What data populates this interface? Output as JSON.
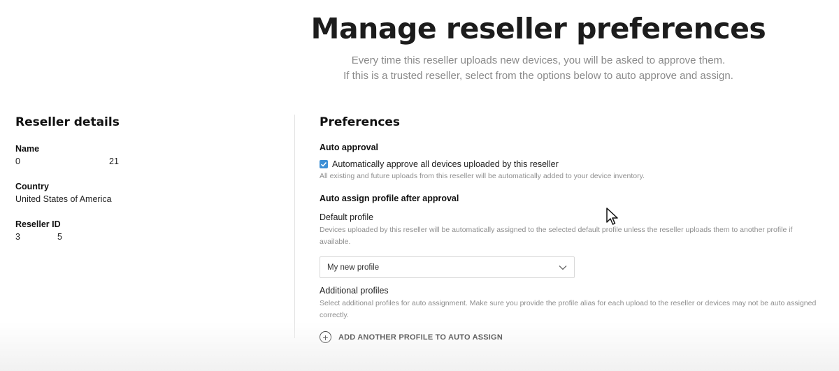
{
  "header": {
    "title": "Manage reseller preferences",
    "subtitle_line1": "Every time this reseller uploads new devices, you will be asked to approve them.",
    "subtitle_line2": "If this is a trusted reseller, select from the options below to auto approve and assign."
  },
  "reseller_details": {
    "title": "Reseller details",
    "name_label": "Name",
    "name_value_start": "0",
    "name_value_end": "21",
    "country_label": "Country",
    "country_value": "United States of America",
    "reseller_id_label": "Reseller ID",
    "reseller_id_start": "3",
    "reseller_id_end": "5"
  },
  "preferences": {
    "title": "Preferences",
    "auto_approval_heading": "Auto approval",
    "auto_approve_checkbox_label": "Automatically approve all devices uploaded by this reseller",
    "auto_approve_checked": true,
    "auto_approve_hint": "All existing and future uploads from this reseller will be automatically added to your device inventory.",
    "auto_assign_heading": "Auto assign profile after approval",
    "default_profile_label": "Default profile",
    "default_profile_hint": "Devices uploaded by this reseller will be automatically assigned to the selected default profile unless the reseller uploads them to another profile if available.",
    "default_profile_selected": "My new profile",
    "additional_profiles_label": "Additional profiles",
    "additional_profiles_hint": "Select additional profiles for auto assignment. Make sure you provide the profile alias for each upload to the reseller or devices may not be auto assigned correctly.",
    "add_profile_button_label": "ADD ANOTHER PROFILE TO AUTO ASSIGN"
  },
  "colors": {
    "checkbox_accent": "#3c8fd6",
    "hint_text": "#8e8e8e"
  }
}
